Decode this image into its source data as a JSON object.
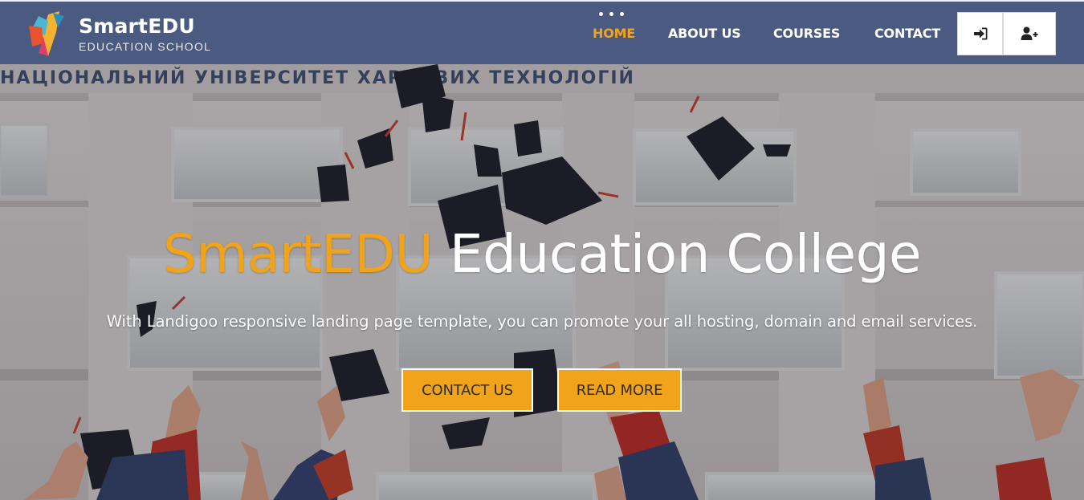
{
  "brand": {
    "name": "SmartEDU",
    "tagline": "EDUCATION SCHOOL"
  },
  "nav": {
    "items": [
      {
        "label": "HOME",
        "active": true
      },
      {
        "label": "ABOUT US",
        "active": false
      },
      {
        "label": "COURSES",
        "active": false
      },
      {
        "label": "CONTACT",
        "active": false
      }
    ],
    "login_icon": "sign-in-icon",
    "register_icon": "user-plus-icon"
  },
  "hero": {
    "title_accent": "SmartEDU",
    "title_rest": " Education College",
    "subtitle": "With Landigoo responsive landing page template, you can promote your all hosting, domain and email services.",
    "building_sign": "НАЦІОНАЛЬНИЙ УНІВЕРСИТЕТ ХАРЧОВИХ ТЕХНОЛОГІЙ",
    "buttons": {
      "contact": "CONTACT US",
      "read_more": "READ MORE"
    }
  },
  "colors": {
    "navbar": "#4b5a80",
    "accent": "#f0a31b",
    "white": "#ffffff"
  }
}
